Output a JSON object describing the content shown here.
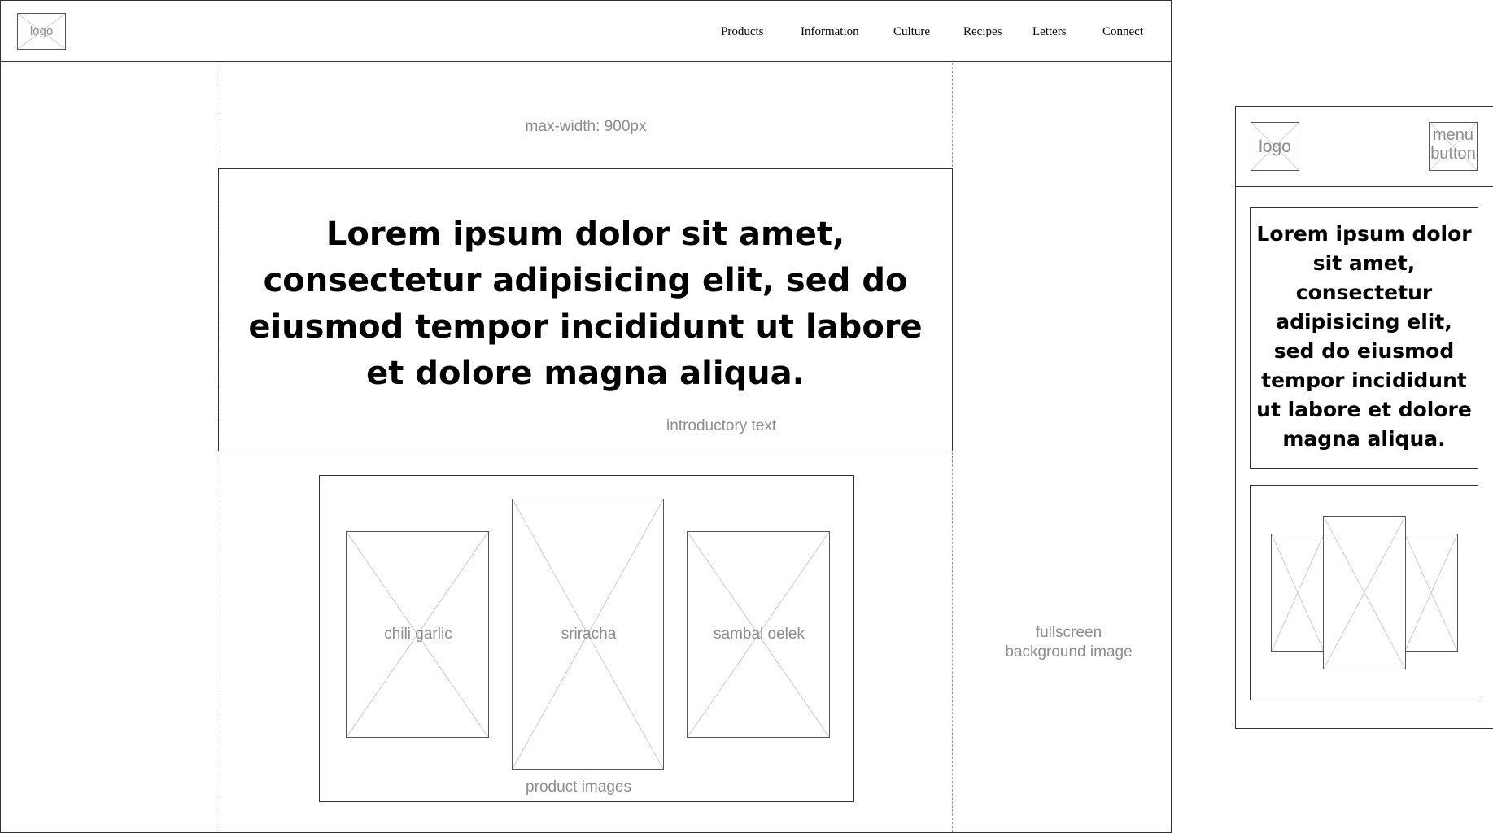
{
  "desktop": {
    "logo_label": "logo",
    "nav_items": [
      "Products",
      "Information",
      "Culture",
      "Recipes",
      "Letters",
      "Connect"
    ],
    "max_width_note": "max-width: 900px",
    "intro_heading": "Lorem ipsum dolor sit amet, consectetur adipisicing elit, sed do eiusmod tempor incididunt ut labore et dolore magna aliqua.",
    "intro_note": "introductory text",
    "products": [
      "chili garlic",
      "sriracha",
      "sambal oelek"
    ],
    "products_note": "product images",
    "background_note_line1": "fullscreen",
    "background_note_line2": "background image"
  },
  "mobile": {
    "logo_label": "logo",
    "menu_button_line1": "menu",
    "menu_button_line2": "button",
    "intro_heading": "Lorem ipsum dolor sit amet, consectetur adipisicing elit, sed do eiusmod tempor incididunt ut labore et dolore magna aliqua."
  },
  "colors": {
    "outline": "#333333",
    "placeholder_cross": "#cccccc",
    "note_text": "#8c8c8c",
    "guide_dash": "#999999"
  }
}
